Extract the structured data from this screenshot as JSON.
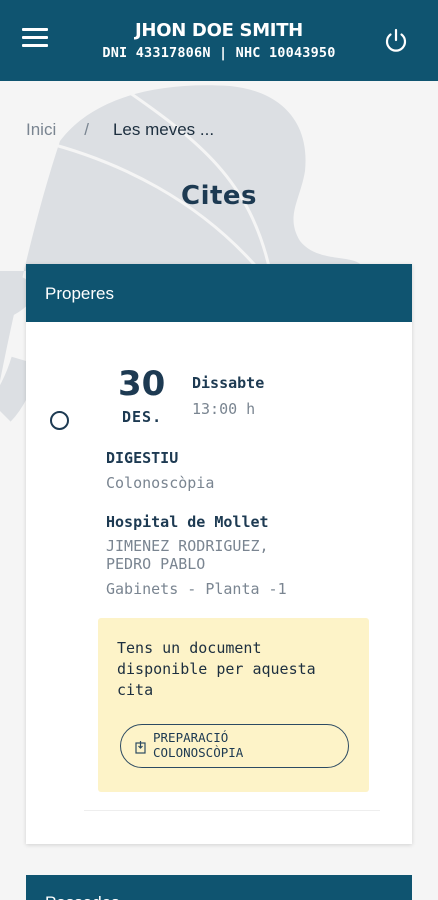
{
  "header": {
    "user_name": "JHON DOE SMITH",
    "user_ids": "DNI 43317806N | NHC 10043950",
    "menu_icon": "hamburger-menu-icon",
    "power_icon": "power-icon",
    "color": "#0f5470"
  },
  "breadcrumb": {
    "home": "Inici",
    "separator": "/",
    "current": "Les meves ..."
  },
  "page": {
    "title": "Cites"
  },
  "upcoming": {
    "title": "Properes",
    "appointment": {
      "day": "30",
      "month": "DES.",
      "weekday": "Dissabte",
      "time": "13:00 h",
      "service": "DIGESTIU",
      "procedure": "Colonoscòpia",
      "hospital": "Hospital de Mollet",
      "doctor_line1": "JIMENEZ RODRIGUEZ,",
      "doctor_line2": "PEDRO PABLO",
      "location": "Gabinets - Planta -1",
      "document_notice": "Tens un document disponible per aquesta cita",
      "document_button_line1": "PREPARACIÓ",
      "document_button_line2": "COLONOSCÒPIA",
      "document_icon": "document-icon"
    }
  },
  "past": {
    "title": "Passades"
  },
  "colors": {
    "primary": "#0f5470",
    "text_dark": "#1d3a52",
    "text_grey": "#7a8591",
    "notice_bg": "#fdf3c8"
  }
}
